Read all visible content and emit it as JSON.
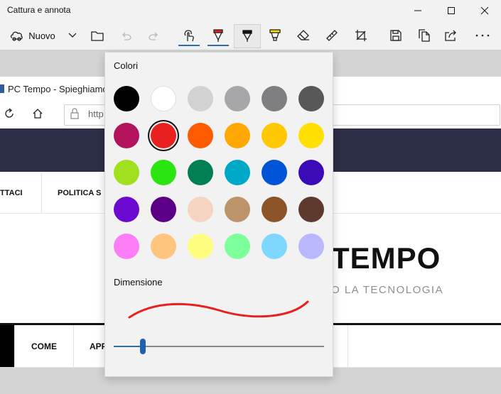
{
  "window": {
    "title": "Cattura e annota"
  },
  "toolbar": {
    "nuovo_label": "Nuovo",
    "icons": [
      "new-snip-icon",
      "chevron-down-icon",
      "folder-icon",
      "undo-icon",
      "redo-icon",
      "touch-writing-icon",
      "ballpoint-pen-icon",
      "pencil-icon",
      "highlighter-icon",
      "eraser-icon",
      "ruler-icon",
      "crop-icon",
      "save-icon",
      "copy-icon",
      "share-icon",
      "more-icon"
    ],
    "selected_tool_color": "#e8201f"
  },
  "browser": {
    "tab_title": "PC Tempo - Spieghiamo",
    "url_text": "http",
    "menu": [
      "TTACI",
      "POLITICA S"
    ],
    "logo": "TEMPO",
    "subtitle": "O LA TECNOLOGIA",
    "nav2": [
      "COME",
      "APP"
    ]
  },
  "flyout": {
    "colors_label": "Colori",
    "size_label": "Dimensione",
    "selected_color": "#e8201f",
    "size_value": 0.14,
    "colors": [
      [
        "#000000",
        "#ffffff",
        "#d2d2d2",
        "#a7a7a9",
        "#7f7f81",
        "#585858"
      ],
      [
        "#b3135b",
        "#e8201f",
        "#ff5a00",
        "#ffa800",
        "#ffc800",
        "#ffe000"
      ],
      [
        "#a0e01f",
        "#2ae50f",
        "#007f53",
        "#00a8c8",
        "#0054d8",
        "#3c0bb8"
      ],
      [
        "#6c0ad2",
        "#5b0086",
        "#f6d4c2",
        "#bd936a",
        "#8c5228",
        "#5d3a2d"
      ],
      [
        "#fb7ef7",
        "#ffc47e",
        "#fffd7f",
        "#7dff99",
        "#7ed7ff",
        "#b9b8ff"
      ]
    ]
  }
}
